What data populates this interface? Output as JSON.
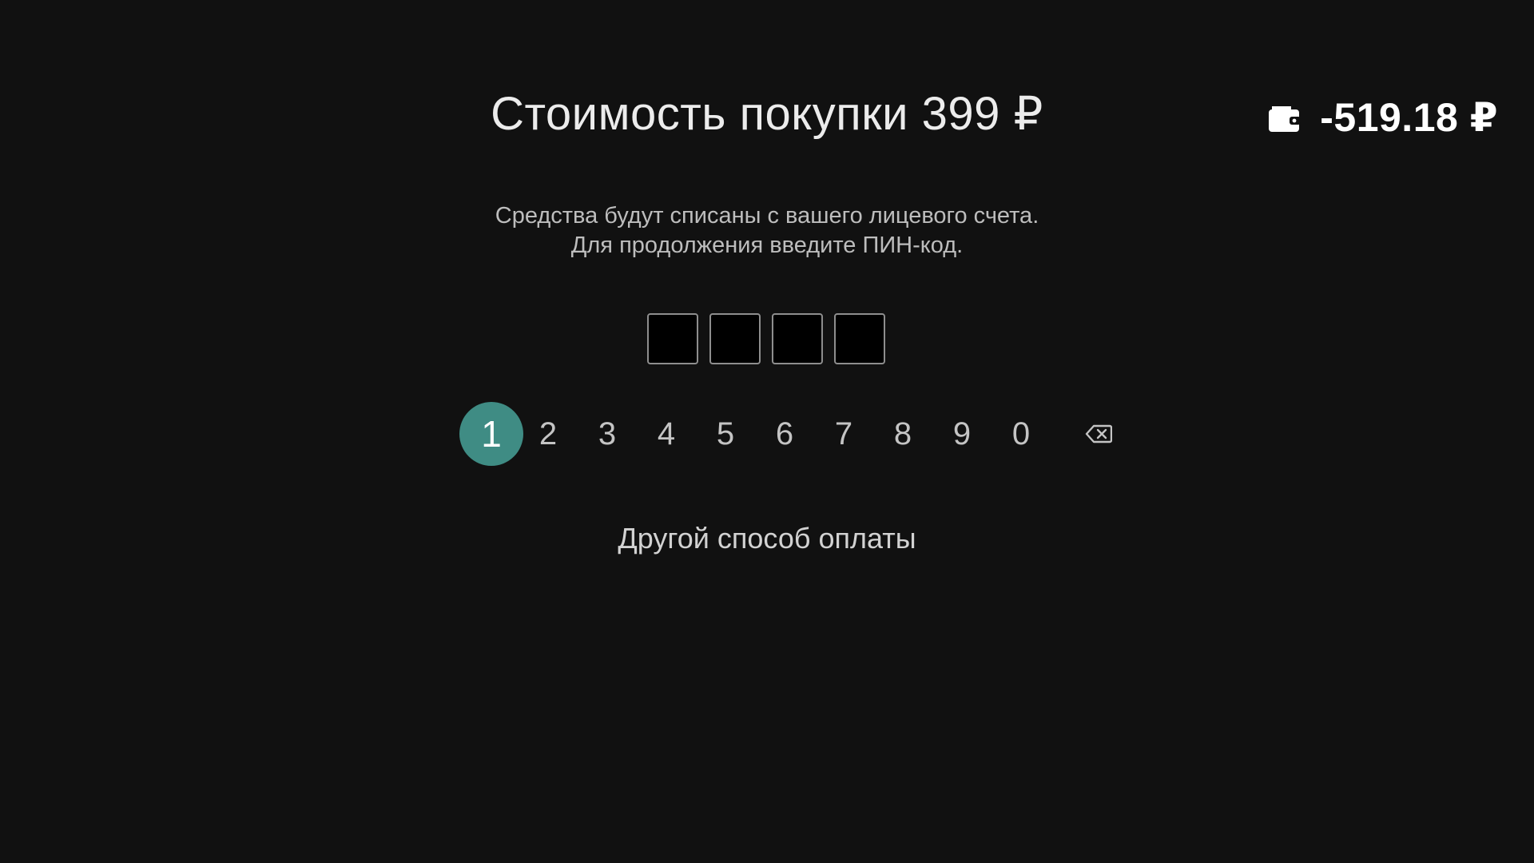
{
  "header": {
    "title": "Стоимость покупки 399 ₽"
  },
  "balance": {
    "icon": "wallet-icon",
    "value": "-519.18 ₽"
  },
  "description": {
    "line1": "Средства будут списаны с вашего лицевого счета.",
    "line2": "Для продолжения введите ПИН-код."
  },
  "pin": {
    "length": 4,
    "entered": [
      "",
      "",
      "",
      ""
    ]
  },
  "keypad": {
    "keys": [
      "1",
      "2",
      "3",
      "4",
      "5",
      "6",
      "7",
      "8",
      "9",
      "0"
    ],
    "focused_key": "1",
    "backspace_icon": "backspace-icon"
  },
  "actions": {
    "other_payment": "Другой способ оплаты"
  },
  "colors": {
    "background": "#111111",
    "focus_accent": "#3f8c84",
    "pin_box_border": "#8e8e8e"
  }
}
